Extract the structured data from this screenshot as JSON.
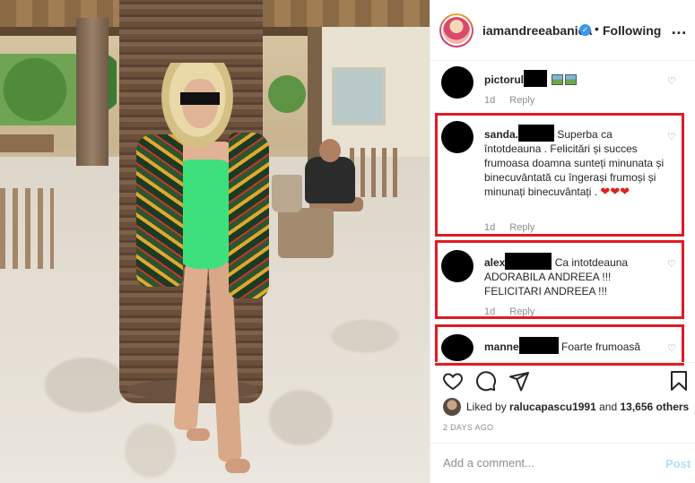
{
  "header": {
    "username": "iamandreeabanica",
    "verified_icon": "verified-badge-icon",
    "separator": "•",
    "follow_status": "Following",
    "more_icon": "…"
  },
  "comments": [
    {
      "username": "pictorul",
      "text": "",
      "time": "1d",
      "reply_label": "Reply",
      "highlighted": false
    },
    {
      "username": "sanda.",
      "text": "Superba ca întotdeauna . Felicitări și succes frumoasa doamna sunteți minunata și binecuvântată cu îngerași frumoși și minunați binecuvântați .",
      "time": "1d",
      "reply_label": "Reply",
      "highlighted": true,
      "hearts": "❤❤❤"
    },
    {
      "username": "alex",
      "text": "Ca intotdeauna ADORABILA ANDREEA !!! FELICITARI ANDREEA !!!",
      "time": "1d",
      "reply_label": "Reply",
      "highlighted": true
    },
    {
      "username": "manne",
      "text": "Foarte frumoasă",
      "highlighted": true
    }
  ],
  "likes": {
    "prefix": "Liked by",
    "user": "ralucapascu1991",
    "middle": "and",
    "count": "13,656 others"
  },
  "timestamp": "2 DAYS AGO",
  "add_comment": {
    "placeholder": "Add a comment...",
    "post_label": "Post"
  },
  "colors": {
    "highlight": "#e01b24",
    "link_blue": "#3897f0",
    "post_disabled": "#b2dffc",
    "meta_gray": "#8e8e8e"
  }
}
